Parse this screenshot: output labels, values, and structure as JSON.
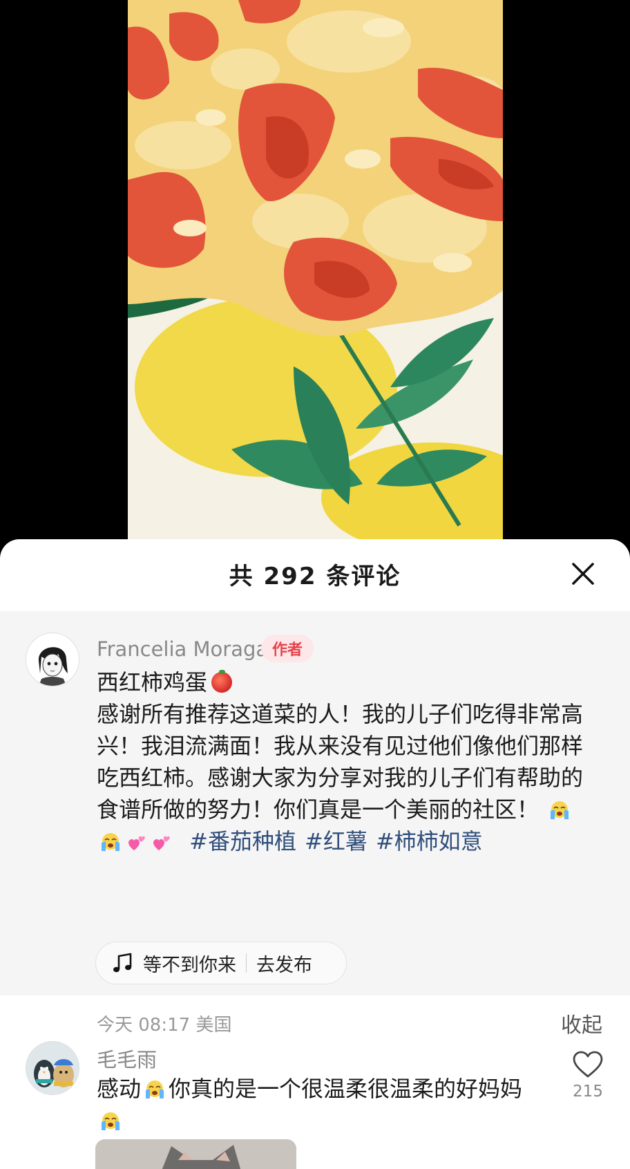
{
  "header": {
    "title": "共 292 条评论"
  },
  "author_comment": {
    "name": "Francelia Moraga",
    "badge": "作者",
    "title": "西红柿鸡蛋",
    "body": "感谢所有推荐这道菜的人！我的儿子们吃得非常高兴！我泪流满面！我从来没有见过他们像他们那样吃西红柿。感谢大家为分享对我的儿子们有帮助的食谱所做的努力！你们真是一个美丽的社区！",
    "hashtags": [
      "#番茄种植",
      "#红薯",
      "#柿柿如意"
    ],
    "music": {
      "song": "等不到你来",
      "action": "去发布"
    },
    "meta": "今天 08:17 美国",
    "collapse_label": "收起"
  },
  "reply_comment": {
    "name": "毛毛雨",
    "text_part1": "感动",
    "text_part2": "你真的是一个很温柔很温柔的好妈妈",
    "likes": "215"
  },
  "icons": {
    "close": "close-icon",
    "music": "music-note-icon",
    "like": "heart-outline-icon",
    "emojis": [
      "crying-emoji",
      "crying-emoji",
      "two-hearts-emoji",
      "two-hearts-emoji",
      "tomato-emoji"
    ]
  },
  "colors": {
    "hashtag": "#304e7c",
    "badge_text": "#e8424b",
    "badge_bg": "#fde7e8",
    "pinned_bg": "#f5f5f5"
  }
}
